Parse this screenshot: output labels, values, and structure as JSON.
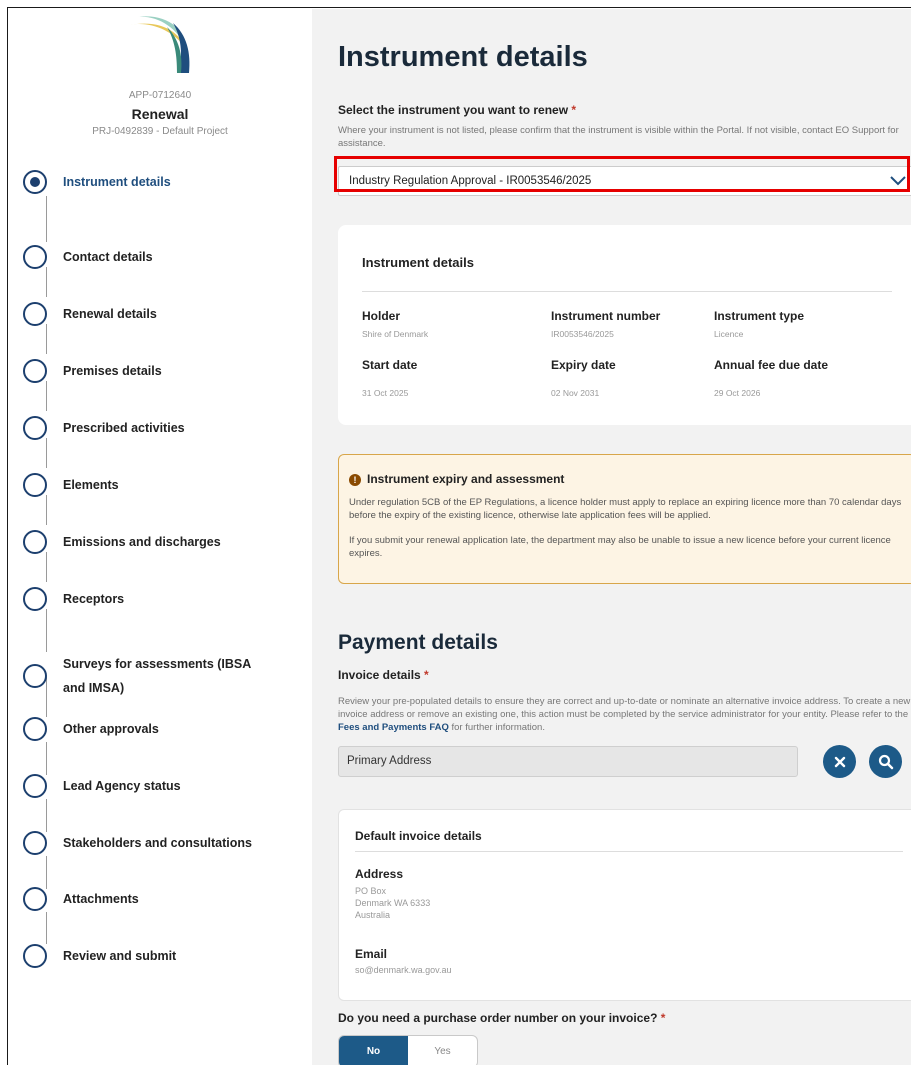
{
  "sidebar": {
    "app_id": "APP-0712640",
    "title": "Renewal",
    "project": "PRJ-0492839 - Default Project",
    "steps": [
      {
        "label": "Instrument details",
        "active": true
      },
      {
        "label": "Contact details"
      },
      {
        "label": "Renewal details"
      },
      {
        "label": "Premises details"
      },
      {
        "label": "Prescribed activities"
      },
      {
        "label": "Elements"
      },
      {
        "label": "Emissions and discharges"
      },
      {
        "label": "Receptors"
      },
      {
        "label": "Surveys for assessments (IBSA",
        "label2": "and IMSA)"
      },
      {
        "label": "Other approvals"
      },
      {
        "label": "Lead Agency status"
      },
      {
        "label": "Stakeholders and consultations"
      },
      {
        "label": "Attachments"
      },
      {
        "label": "Review and submit"
      }
    ]
  },
  "main": {
    "page_title": "Instrument details",
    "select_question": "Select the instrument you want to renew",
    "required_mark": "*",
    "select_helper": "Where your instrument is not listed, please confirm that the instrument is visible within the Portal. If not visible, contact EO Support for assistance.",
    "select_value": "Industry Regulation Approval - IR0053546/2025",
    "details_card": {
      "title": "Instrument details",
      "holder_label": "Holder",
      "holder_value": "Shire of Denmark",
      "instr_num_label": "Instrument number",
      "instr_num_value": "IR0053546/2025",
      "instr_type_label": "Instrument type",
      "instr_type_value": "Licence",
      "start_label": "Start date",
      "start_value": "31 Oct 2025",
      "expiry_label": "Expiry date",
      "expiry_value": "02 Nov 2031",
      "fee_label": "Annual fee due date",
      "fee_value": "29 Oct 2026"
    },
    "warning": {
      "icon": "!",
      "title": "Instrument expiry and assessment",
      "p1": "Under regulation 5CB of the EP Regulations, a licence holder must apply to replace an expiring licence more than 70 calendar days before the expiry of the existing licence, otherwise late application fees will be applied.",
      "p2": "If you submit your renewal application late, the department may also be unable to issue a new licence before your current licence expires."
    },
    "payment": {
      "title": "Payment details",
      "invoice_label": "Invoice details",
      "helper_pre": "Review your pre-populated details to ensure they are correct and up-to-date or nominate an alternative invoice address. To create a new invoice address or remove an existing one, this action must be completed by the service administrator for your entity. Please refer to the ",
      "helper_link": "Fees and Payments FAQ",
      "helper_post": " for further information.",
      "address_value": "Primary Address",
      "card_title": "Default invoice details",
      "address_label": "Address",
      "address_lines": [
        "PO Box",
        "Denmark  WA  6333",
        "Australia"
      ],
      "email_label": "Email",
      "email_value": "so@denmark.wa.gov.au",
      "po_question": "Do you need a purchase order number on your invoice?",
      "po_no": "No",
      "po_yes": "Yes"
    }
  },
  "colors": {
    "navy": "#1c3f6e",
    "button_blue": "#1d5a88",
    "highlight_red": "#e60000",
    "warning_bg": "#fdf4e4",
    "warning_border": "#d8a64a"
  }
}
